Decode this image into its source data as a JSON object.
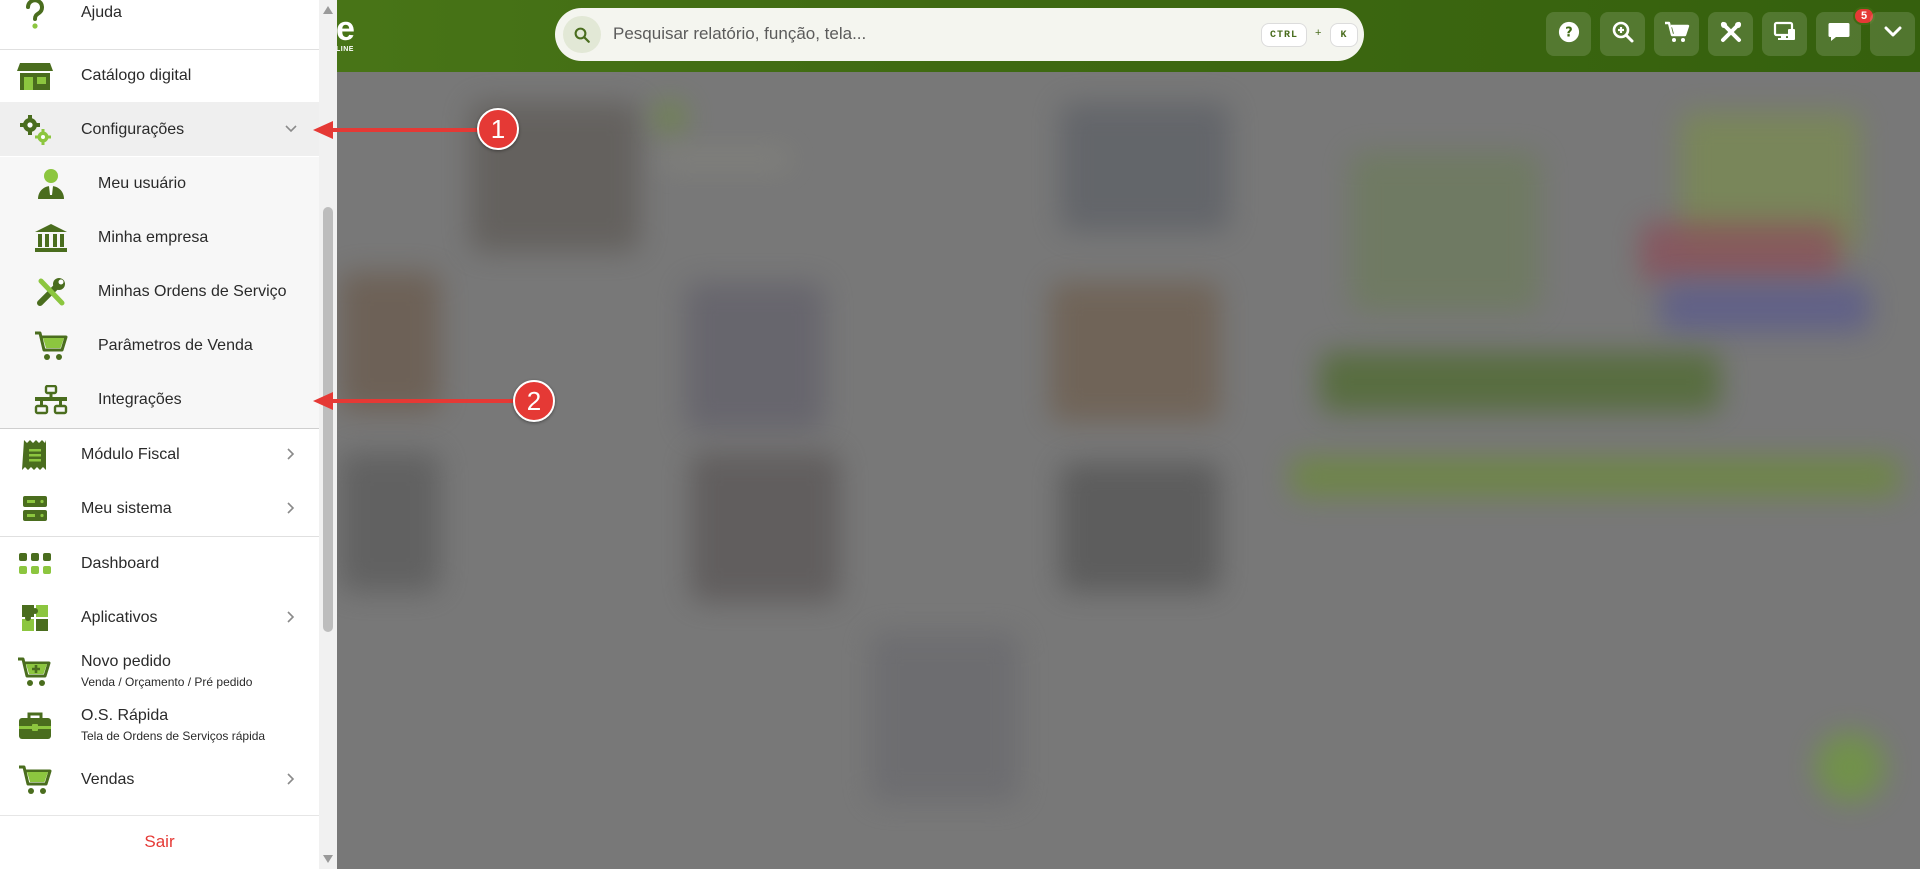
{
  "header": {
    "logo_fragment": "e",
    "logo_sub": "LINE",
    "search_placeholder": "Pesquisar relatório, função, tela...",
    "shortcut_ctrl": "CTRL",
    "shortcut_plus": "+",
    "shortcut_key": "K",
    "notification_count": "5"
  },
  "sidebar": {
    "top_item": "Ajuda",
    "items": [
      {
        "label": "Catálogo digital"
      },
      {
        "label": "Configurações",
        "expanded": true
      },
      {
        "label": "Módulo Fiscal"
      },
      {
        "label": "Meu sistema"
      },
      {
        "label": "Dashboard"
      },
      {
        "label": "Aplicativos"
      },
      {
        "label": "Novo pedido",
        "sub": "Venda / Orçamento / Pré pedido"
      },
      {
        "label": "O.S. Rápida",
        "sub": "Tela de Ordens de Serviços rápida"
      },
      {
        "label": "Vendas"
      }
    ],
    "config_sub_items": [
      {
        "label": "Meu usuário"
      },
      {
        "label": "Minha empresa"
      },
      {
        "label": "Minhas Ordens de Serviço"
      },
      {
        "label": "Parâmetros de Venda"
      },
      {
        "label": "Integrações"
      }
    ],
    "logout": "Sair"
  },
  "annotations": {
    "callout_1": "1",
    "callout_2": "2"
  },
  "colors": {
    "brand_green": "#3f6a12",
    "icon_green": "#4a6d1e",
    "icon_light": "#8cc63f",
    "arrow_red": "#e53935"
  }
}
